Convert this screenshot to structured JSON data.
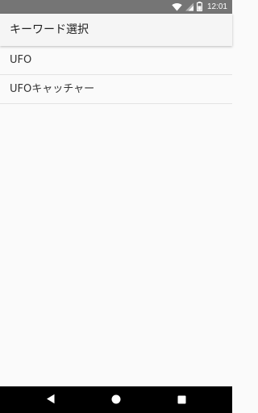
{
  "status_bar": {
    "time": "12:01",
    "icons": [
      "wifi-icon",
      "cell-signal-icon",
      "battery-icon"
    ]
  },
  "app_bar": {
    "title": "キーワード選択"
  },
  "keywords": [
    {
      "label": "UFO"
    },
    {
      "label": "UFOキャッチャー"
    }
  ],
  "nav_bar": {
    "buttons": [
      "back-icon",
      "home-icon",
      "recents-icon"
    ]
  },
  "colors": {
    "status_bar": "#757575",
    "app_bar": "#f5f5f5",
    "background": "#fafafa",
    "nav_bar": "#000000",
    "divider": "#e3e3e3"
  }
}
